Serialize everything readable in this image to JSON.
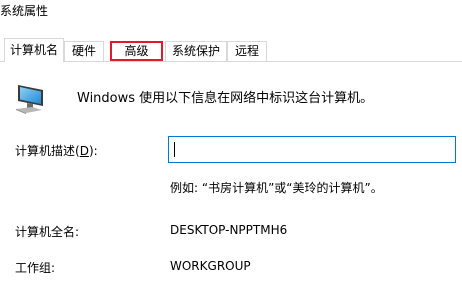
{
  "window": {
    "title": "系统属性"
  },
  "tabs": [
    {
      "label": "计算机名",
      "active": true
    },
    {
      "label": "硬件",
      "active": false
    },
    {
      "label": "高级",
      "active": false,
      "highlighted": true
    },
    {
      "label": "系统保护",
      "active": false
    },
    {
      "label": "远程",
      "active": false
    }
  ],
  "computer_name_tab": {
    "intro": "Windows 使用以下信息在网络中标识这台计算机。",
    "description_label": "计算机描述(D):",
    "description_label_prefix": "计算机描述(",
    "description_label_key": "D",
    "description_label_suffix": "):",
    "description_value": "",
    "example_text": "例如: “书房计算机”或“美玲的计算机”。",
    "full_name_label": "计算机全名:",
    "full_name_value": "DESKTOP-NPPTMH6",
    "workgroup_label": "工作组:",
    "workgroup_value": "WORKGROUP"
  },
  "colors": {
    "highlight_border": "#e6192b",
    "input_focus_border": "#0078d7",
    "tab_border": "#d9d9d9"
  },
  "icons": {
    "computer": "computer-monitor-icon"
  }
}
